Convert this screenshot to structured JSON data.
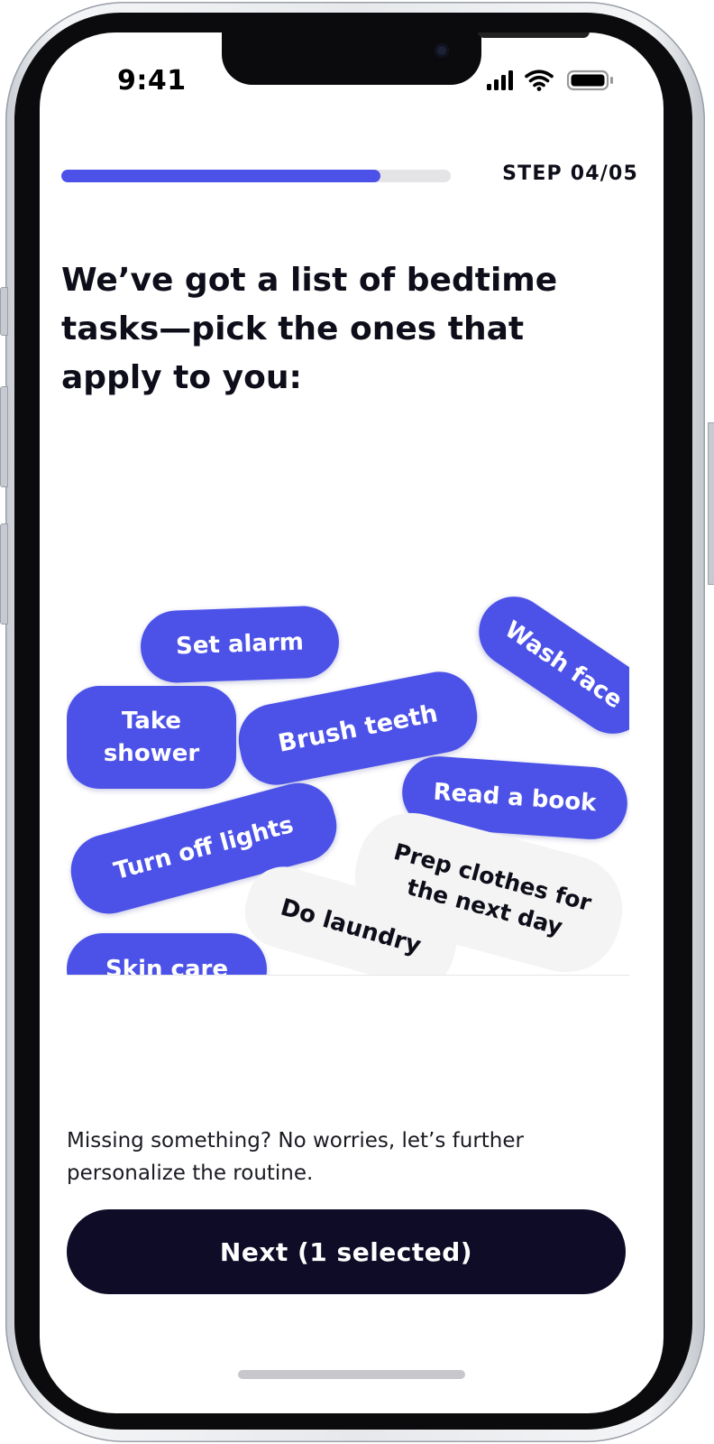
{
  "status_bar": {
    "time": "9:41"
  },
  "progress": {
    "fraction": 0.82,
    "step_label": "STEP 04/05"
  },
  "headline": "We’ve got a list of bedtime tasks—pick the ones that apply to you:",
  "tasks": [
    {
      "label": "Set alarm",
      "selected": true
    },
    {
      "label": "Wash face",
      "selected": true
    },
    {
      "label": "Brush teeth",
      "selected": true
    },
    {
      "label": "Take\nshower",
      "selected": true
    },
    {
      "label": "Read a book",
      "selected": true
    },
    {
      "label": "Turn off lights",
      "selected": true
    },
    {
      "label": "Prep clothes for\nthe next day",
      "selected": false
    },
    {
      "label": "Do laundry",
      "selected": false
    },
    {
      "label": "Skin care",
      "selected": true
    }
  ],
  "helper_text": "Missing something? No worries, let’s further personalize the routine.",
  "next_button": {
    "label": "Next (1 selected)"
  },
  "colors": {
    "accent": "#4c52e8",
    "button_dark": "#0e0c26",
    "chip_inactive": "#f4f4f4"
  }
}
